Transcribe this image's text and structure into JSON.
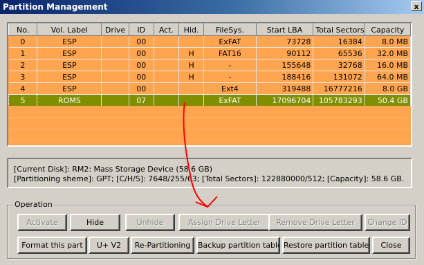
{
  "window": {
    "title": "Partition Management",
    "close_label": "x"
  },
  "table": {
    "columns": [
      "No.",
      "Vol. Label",
      "Drive",
      "ID",
      "Act.",
      "Hid.",
      "FileSys.",
      "Start LBA",
      "Total Sectors",
      "Capacity"
    ],
    "rows": [
      {
        "no": "0",
        "label": "ESP",
        "drive": "",
        "id": "00",
        "act": "",
        "hid": "",
        "fs": "ExFAT",
        "start": "73728",
        "total": "16384",
        "cap": "8.0 MB"
      },
      {
        "no": "1",
        "label": "ESP",
        "drive": "",
        "id": "00",
        "act": "",
        "hid": "H",
        "fs": "FAT16",
        "start": "90112",
        "total": "65536",
        "cap": "32.0 MB"
      },
      {
        "no": "2",
        "label": "ESP",
        "drive": "",
        "id": "00",
        "act": "",
        "hid": "H",
        "fs": "-",
        "start": "155648",
        "total": "32768",
        "cap": "16.0 MB"
      },
      {
        "no": "3",
        "label": "ESP",
        "drive": "",
        "id": "00",
        "act": "",
        "hid": "H",
        "fs": "-",
        "start": "188416",
        "total": "131072",
        "cap": "64.0 MB"
      },
      {
        "no": "4",
        "label": "ESP",
        "drive": "",
        "id": "00",
        "act": "",
        "hid": "",
        "fs": "Ext4",
        "start": "319488",
        "total": "16777216",
        "cap": "8.0 GB"
      },
      {
        "no": "5",
        "label": "ROMS",
        "drive": "",
        "id": "07",
        "act": "",
        "hid": "",
        "fs": "ExFAT",
        "start": "17096704",
        "total": "105783293",
        "cap": "50.4 GB"
      }
    ],
    "selected_row": "5"
  },
  "info": {
    "line1": "[Current Disk]:   RM2: Mass Storage Device (58.6 GB)",
    "line2": "[Partitioning sheme]:    GPT;     [C/H/S]:  7648/255/63;  [Total Sectors]:  122880000/512;  [Capacity]:  58.6 GB."
  },
  "operation": {
    "group_label": "Operation",
    "row1": [
      {
        "label": "Activate",
        "enabled": false
      },
      {
        "label": "Hide",
        "enabled": true
      },
      {
        "label": "Unhide",
        "enabled": false
      },
      {
        "label": "Assign Drive Letter",
        "enabled": false
      },
      {
        "label": "Remove Drive Letter",
        "enabled": false
      },
      {
        "label": "Change ID",
        "enabled": false
      }
    ],
    "row2": [
      {
        "label": "Format this part",
        "enabled": true
      },
      {
        "label": "U+ V2",
        "enabled": true
      },
      {
        "label": "Re-Partitioning",
        "enabled": true
      },
      {
        "label": "Backup partition table",
        "enabled": true
      },
      {
        "label": "Restore partition table",
        "enabled": true
      },
      {
        "label": "Close",
        "enabled": true
      }
    ]
  },
  "colors": {
    "grid_bg": "#ffa550",
    "selected_row_bg": "#7f8f00",
    "annotation_arrow": "#ff0000"
  }
}
